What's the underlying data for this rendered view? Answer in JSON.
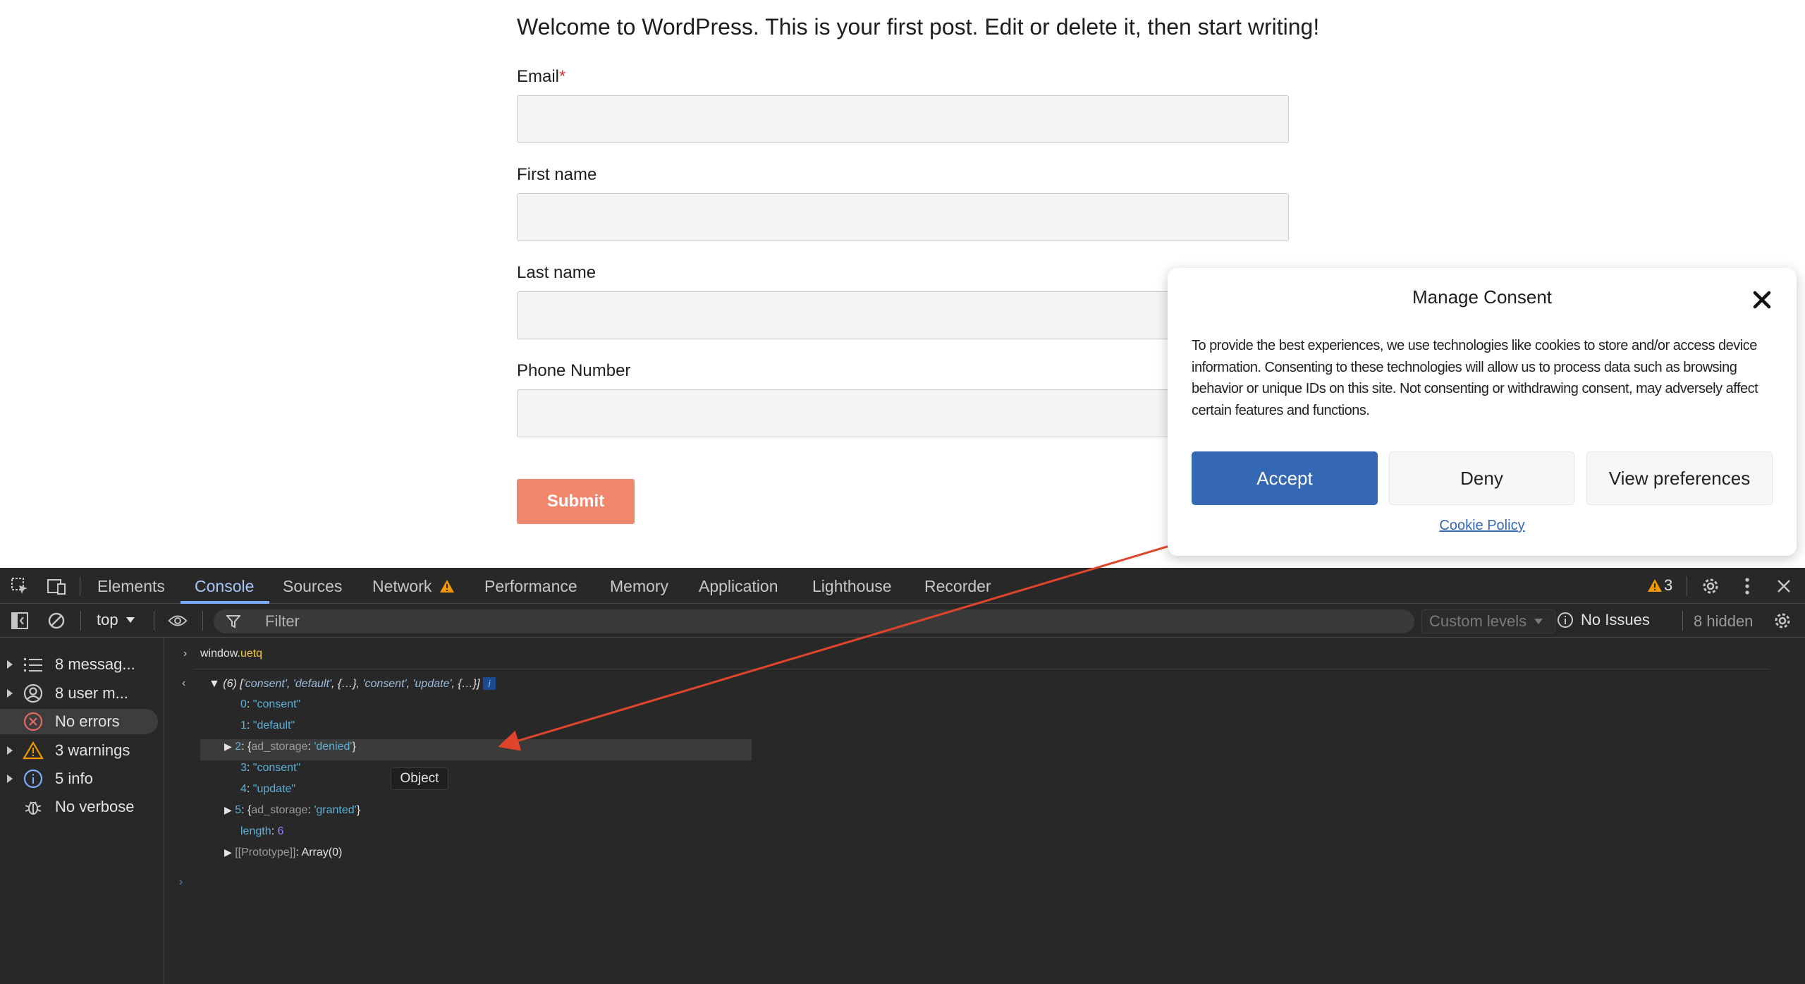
{
  "page": {
    "intro": "Welcome to WordPress. This is your first post. Edit or delete it, then start writing!",
    "fields": [
      {
        "label": "Email",
        "required_mark": "*"
      },
      {
        "label": "First name"
      },
      {
        "label": "Last name"
      },
      {
        "label": "Phone Number"
      }
    ],
    "submit_label": "Submit"
  },
  "consent_modal": {
    "title": "Manage Consent",
    "text": "To provide the best experiences, we use technologies like cookies to store and/or access device information. Consenting to these technologies will allow us to process data such as browsing behavior or unique IDs on this site. Not consenting or withdrawing consent, may adversely affect certain features and functions.",
    "accept_label": "Accept",
    "deny_label": "Deny",
    "prefs_label": "View preferences",
    "policy_link": "Cookie Policy",
    "accent_color": "#3568b4"
  },
  "devtools": {
    "tabs": [
      "Elements",
      "Console",
      "Sources",
      "Network",
      "Performance",
      "Memory",
      "Application",
      "Lighthouse",
      "Recorder"
    ],
    "active_tab": "Console",
    "warning_count": "3",
    "context": "top",
    "filter_placeholder": "Filter",
    "levels_label": "Custom levels",
    "issues_label": "No Issues",
    "hidden_label": "8 hidden",
    "sidebar": [
      {
        "label": "8 messag...",
        "icon": "list-icon"
      },
      {
        "label": "8 user m...",
        "icon": "user-icon"
      },
      {
        "label": "No errors",
        "icon": "error-icon"
      },
      {
        "label": "3 warnings",
        "icon": "warning-icon"
      },
      {
        "label": "5 info",
        "icon": "info-icon"
      },
      {
        "label": "No verbose",
        "icon": "bug-icon"
      }
    ],
    "console": {
      "input": "window.uetq",
      "input_obj": "window",
      "input_prop": "uetq",
      "summary_count": "(6)",
      "summary_items": [
        "'consent'",
        "'default'",
        "{…}",
        "'consent'",
        "'update'",
        "{…}"
      ],
      "entries": [
        {
          "index": "0",
          "value": "\"consent\""
        },
        {
          "index": "1",
          "value": "\"default\""
        },
        {
          "index": "2",
          "key": "ad_storage",
          "value": "'denied'"
        },
        {
          "index": "3",
          "value": "\"consent\""
        },
        {
          "index": "4",
          "value": "\"update\""
        },
        {
          "index": "5",
          "key": "ad_storage",
          "value": "'granted'"
        }
      ],
      "length_key": "length",
      "length_value": "6",
      "prototype_key": "[[Prototype]]",
      "prototype_value": "Array(0)",
      "tooltip": "Object"
    },
    "annotation_color": "#e0452b"
  }
}
